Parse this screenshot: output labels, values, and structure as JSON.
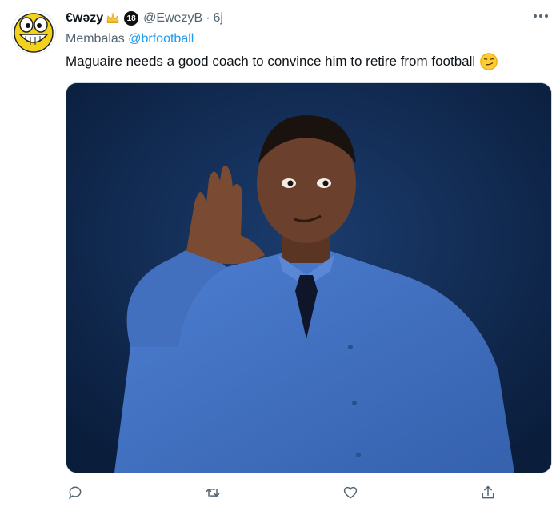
{
  "tweet": {
    "display_name": "€wəzy",
    "age_badge": "18",
    "handle": "@EwezyB",
    "separator": "·",
    "time": "6j",
    "reply_prefix": "Membalas",
    "reply_to": "@brfootball",
    "text": "Maguaire needs a good coach to convince him to retire from football",
    "more_icon": "more-options-icon"
  },
  "actions": {
    "icons": [
      "reply-icon",
      "retweet-icon",
      "like-icon",
      "share-icon"
    ]
  },
  "colors": {
    "accent": "#1d9bf0",
    "secondary_text": "#536471",
    "photo_background": "#0d2447",
    "shirt": "#3f6fc4"
  }
}
